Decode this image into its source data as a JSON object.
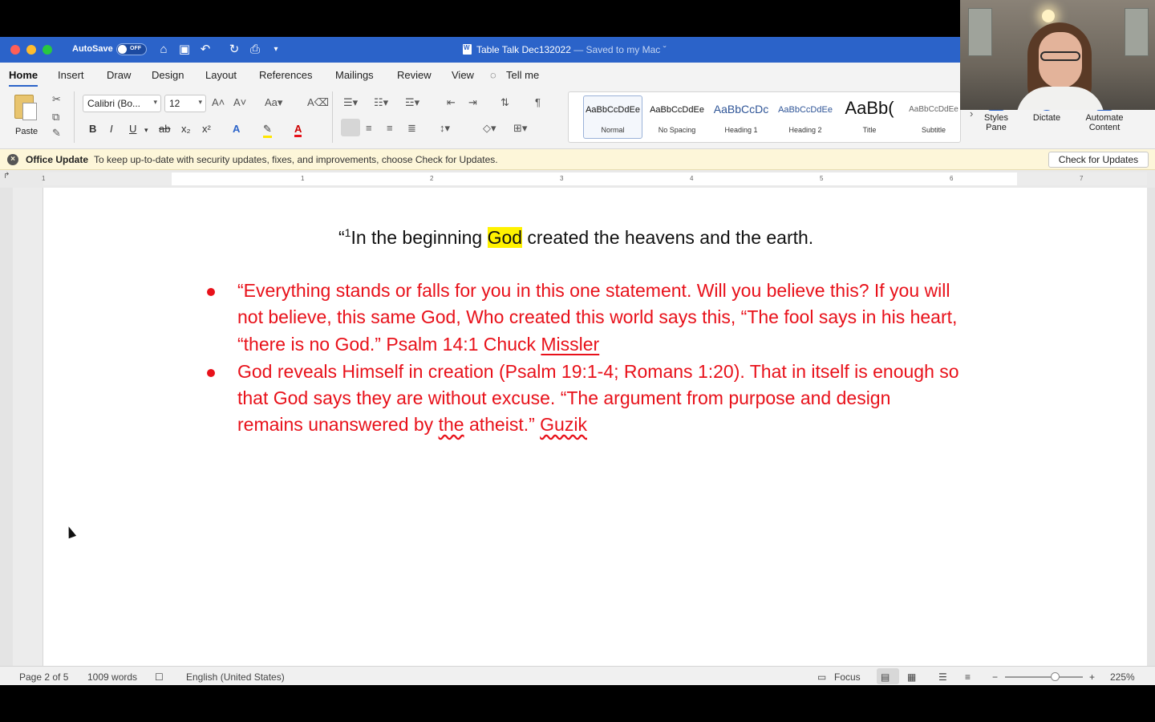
{
  "titlebar": {
    "autosave_label": "AutoSave",
    "autosave_state": "OFF",
    "doc_name": "Table Talk Dec132022",
    "saved_status": "— Saved to my Mac ˇ"
  },
  "tabs": [
    "Home",
    "Insert",
    "Draw",
    "Design",
    "Layout",
    "References",
    "Mailings",
    "Review",
    "View",
    "Tell me"
  ],
  "ribbon": {
    "paste_label": "Paste",
    "font_name": "Calibri (Bo...",
    "font_size": "12",
    "styles": [
      {
        "sample": "AaBbCcDdEe",
        "name": "Normal"
      },
      {
        "sample": "AaBbCcDdEe",
        "name": "No Spacing"
      },
      {
        "sample": "AaBbCcDc",
        "name": "Heading 1"
      },
      {
        "sample": "AaBbCcDdEe",
        "name": "Heading 2"
      },
      {
        "sample": "AaBb(",
        "name": "Title"
      },
      {
        "sample": "AaBbCcDdEe",
        "name": "Subtitle"
      }
    ],
    "styles_pane": [
      "Styles",
      "Pane"
    ],
    "dictate": "Dictate",
    "automate": [
      "Automate",
      "Content"
    ]
  },
  "update_bar": {
    "title": "Office Update",
    "message": "To keep up-to-date with security updates, fixes, and improvements, choose Check for Updates.",
    "button": "Check for Updates"
  },
  "ruler_numbers": [
    "1",
    "1",
    "2",
    "3",
    "4",
    "5",
    "6",
    "7"
  ],
  "document": {
    "line1": {
      "open_quote": "“",
      "sup": "1",
      "pre": "In the beginning ",
      "highlight": "God",
      "post": " created the heavens and the earth."
    },
    "bullet1": {
      "line1": "“Everything stands or falls for you in this one statement. Will you believe this? If you will",
      "line2": "not believe, this same God, Who created this world says this, “The fool says in his heart,",
      "line3_pre": "“there is no God.” Psalm 14:1 Chuck ",
      "line3_mark": "Missler"
    },
    "bullet2": {
      "line1": "God reveals Himself in creation (Psalm 19:1-4; Romans 1:20). That in itself is enough so",
      "line2": "that God says they are without excuse. “The argument from purpose and design",
      "line3_pre": "remains unanswered by ",
      "line3_mark1": "the",
      "line3_mid": " atheist.” ",
      "line3_mark2": "Guzik"
    }
  },
  "status": {
    "page": "Page 2 of 5",
    "words": "1009 words",
    "language": "English (United States)",
    "focus": "Focus",
    "zoom": "225%"
  },
  "colors": {
    "accent": "#2b63c9",
    "text_red": "#e8111a",
    "highlight": "#fff200"
  }
}
